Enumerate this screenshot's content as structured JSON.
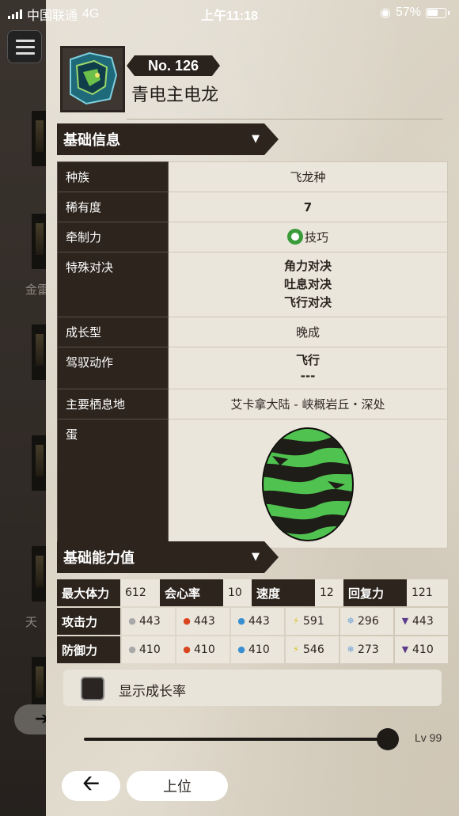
{
  "status_bar": {
    "carrier": "中国联通",
    "network": "4G",
    "time": "上午11:18",
    "battery": "57%"
  },
  "background": {
    "partial_labels": [
      "金雷",
      "天"
    ],
    "back_icon": "back-arrow-icon"
  },
  "header": {
    "number": "No. 126",
    "name": "青电主电龙",
    "icon": "monster-icon"
  },
  "section_basic": {
    "title": "基础信息",
    "rows": [
      {
        "key": "种族",
        "value": "飞龙种"
      },
      {
        "key": "稀有度",
        "value": "7"
      },
      {
        "key": "牵制力",
        "value": "技巧"
      },
      {
        "key": "特殊对决",
        "values": [
          "角力对决",
          "吐息对决",
          "飞行对决"
        ]
      },
      {
        "key": "成长型",
        "value": "晚成"
      },
      {
        "key": "驾驭动作",
        "values": [
          "飞行",
          "---"
        ]
      },
      {
        "key": "主要栖息地",
        "value": "艾卡拿大陆 - 峡概岩丘・深处"
      },
      {
        "key": "蛋",
        "value": ""
      }
    ],
    "egg_colors": {
      "base": "#4fc24f",
      "stripe": "#1f1d18",
      "edge": "#0d0c0a"
    }
  },
  "section_stats": {
    "title": "基础能力值",
    "summary": [
      {
        "label": "最大体力",
        "value": "612"
      },
      {
        "label": "会心率",
        "value": "10"
      },
      {
        "label": "速度",
        "value": "12"
      },
      {
        "label": "回复力",
        "value": "121"
      }
    ],
    "attack": {
      "label": "攻击力",
      "values": [
        {
          "icon": "neutral-icon",
          "value": "443"
        },
        {
          "icon": "fire-icon",
          "value": "443"
        },
        {
          "icon": "water-icon",
          "value": "443"
        },
        {
          "icon": "thunder-icon",
          "value": "591"
        },
        {
          "icon": "ice-icon",
          "value": "296"
        },
        {
          "icon": "dragon-icon",
          "value": "443"
        }
      ]
    },
    "defense": {
      "label": "防御力",
      "values": [
        {
          "icon": "neutral-icon",
          "value": "410"
        },
        {
          "icon": "fire-icon",
          "value": "410"
        },
        {
          "icon": "water-icon",
          "value": "410"
        },
        {
          "icon": "thunder-icon",
          "value": "546"
        },
        {
          "icon": "ice-icon",
          "value": "273"
        },
        {
          "icon": "dragon-icon",
          "value": "410"
        }
      ]
    }
  },
  "growth": {
    "label": "显示成长率",
    "checked": false
  },
  "level": {
    "label": "Lv 99",
    "fraction": 1.0
  },
  "footer": {
    "rank_label": "上位"
  },
  "colors": {
    "dark": "#2c241d",
    "parchment": "#ddd6c8",
    "fire": "#d9451e",
    "water": "#3a8fd0",
    "thunder": "#d6c21a",
    "ice": "#6aa0d6",
    "dragon": "#5c3a8c",
    "neutral": "#a8a8a8"
  }
}
